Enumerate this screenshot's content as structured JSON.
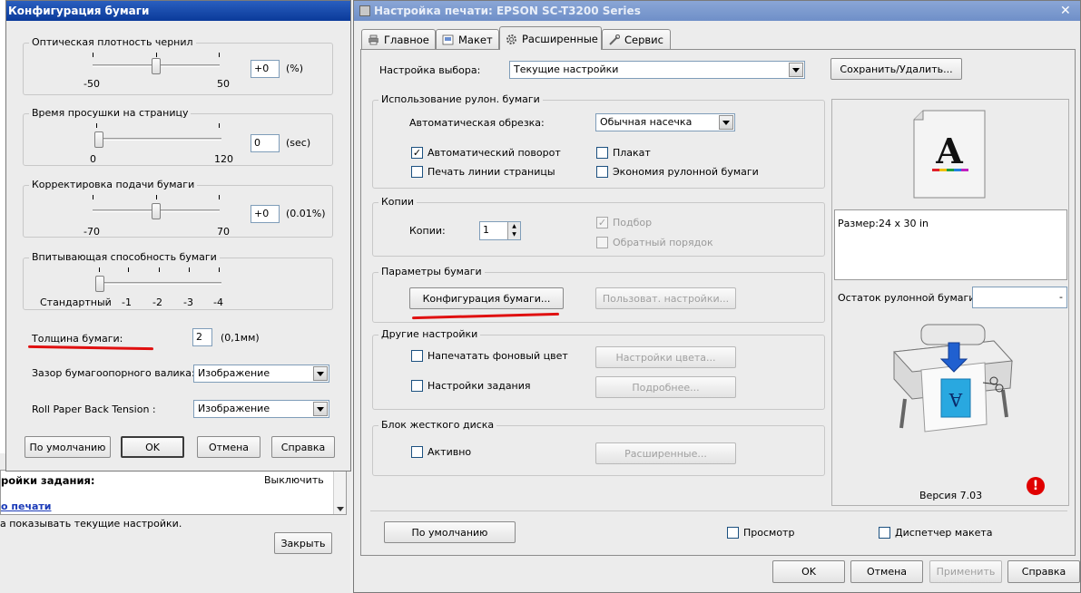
{
  "left_window": {
    "title": "Конфигурация бумаги",
    "ink_density": {
      "label": "Оптическая плотность чернил",
      "min": "-50",
      "max": "50",
      "value": "+0",
      "unit": "(%)",
      "position": 0.5
    },
    "drying_time": {
      "label": "Время просушки на страницу",
      "min": "0",
      "max": "120",
      "value": "0",
      "unit": "(sec)",
      "position": 0.0
    },
    "feed_adjust": {
      "label": "Корректировка подачи бумаги",
      "min": "-70",
      "max": "70",
      "value": "+0",
      "unit": "(0.01%)",
      "position": 0.5
    },
    "suction": {
      "label": "Впитывающая способность бумаги",
      "ticks": [
        "Стандартный",
        "-1",
        "-2",
        "-3",
        "-4"
      ],
      "position": 0.0
    },
    "thickness": {
      "label": "Толщина бумаги:",
      "value": "2",
      "unit": "(0,1мм)"
    },
    "platen_gap": {
      "label": "Зазор бумагоопорного валика:",
      "value": "Изображение"
    },
    "back_tension": {
      "label": "Roll Paper Back Tension :",
      "value": "Изображение"
    },
    "buttons": {
      "default": "По умолчанию",
      "ok": "OK",
      "cancel": "Отмена",
      "help": "Справка"
    }
  },
  "background_window": {
    "row_label": "ройки задания:",
    "row_value": "Выключить",
    "link": "о печати",
    "note": "а показывать текущие настройки.",
    "close_button": "Закрыть"
  },
  "main_window": {
    "title": "Настройка печати: EPSON SC-T3200 Series",
    "tabs": [
      {
        "label": "Главное",
        "icon": "printer-icon"
      },
      {
        "label": "Макет",
        "icon": "layout-icon"
      },
      {
        "label": "Расширенные",
        "icon": "gear-icon"
      },
      {
        "label": "Сервис",
        "icon": "wrench-icon"
      }
    ],
    "select_setting": {
      "label": "Настройка выбора:",
      "value": "Текущие настройки"
    },
    "save_delete_button": "Сохранить/Удалить...",
    "roll_paper": {
      "title": "Использование рулон. бумаги",
      "auto_cut_label": "Автоматическая обрезка:",
      "auto_cut_value": "Обычная насечка",
      "auto_rotate": {
        "label": "Автоматический поворот",
        "checked": true
      },
      "poster": {
        "label": "Плакат",
        "checked": false
      },
      "page_line": {
        "label": "Печать линии страницы",
        "checked": false
      },
      "economy": {
        "label": "Экономия рулонной бумаги",
        "checked": false
      }
    },
    "copies": {
      "title": "Копии",
      "label": "Копии:",
      "value": "1",
      "collate": {
        "label": "Подбор",
        "checked": true
      },
      "reverse": {
        "label": "Обратный порядок",
        "checked": false
      }
    },
    "paper_params": {
      "title": "Параметры бумаги",
      "config_button": "Конфигурация бумаги...",
      "custom_button": "Пользоват. настройки..."
    },
    "other": {
      "title": "Другие настройки",
      "bg_color": {
        "label": "Напечатать фоновый цвет",
        "checked": false
      },
      "color_settings_button": "Настройки цвета...",
      "job_settings": {
        "label": "Настройки задания",
        "checked": false
      },
      "details_button": "Подробнее..."
    },
    "hdd": {
      "title": "Блок жесткого диска",
      "active": {
        "label": "Активно",
        "checked": false
      },
      "advanced_button": "Расширенные..."
    },
    "preview": {
      "size_text": "Размер:24 x 30 in",
      "letter": "A",
      "remaining_label": "Остаток рулонной бумаги:",
      "remaining_value": "-",
      "version": "Версия 7.03"
    },
    "defaults_button": "По умолчанию",
    "preview_check": {
      "label": "Просмотр",
      "checked": false
    },
    "layout_manager": {
      "label": "Диспетчер макета",
      "checked": false
    },
    "buttons": {
      "ok": "OK",
      "cancel": "Отмена",
      "apply": "Применить",
      "help": "Справка"
    }
  },
  "colors": {
    "title_active": "#0a3a9a",
    "annotation": "#e01010",
    "warning": "#e00000"
  }
}
